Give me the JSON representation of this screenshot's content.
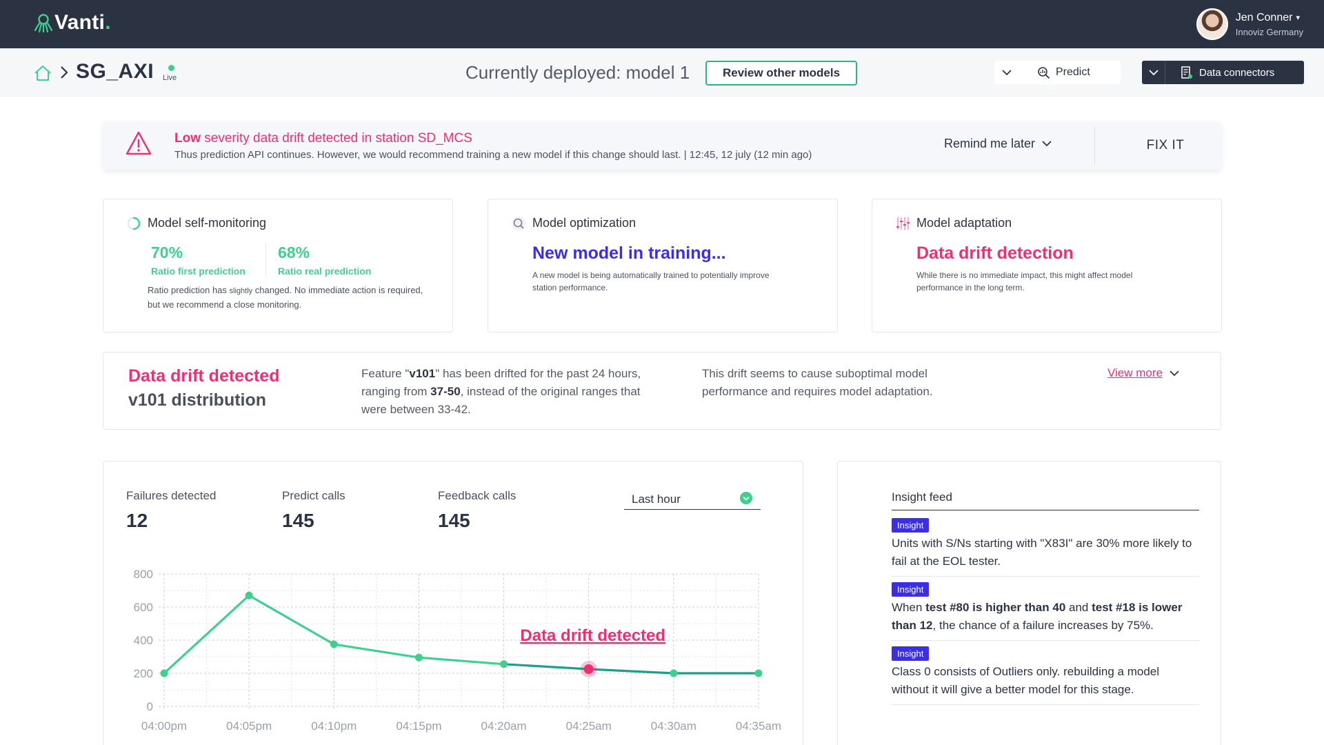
{
  "header": {
    "logo_text": "Vanti",
    "logo_dot": ".",
    "user_name": "Jen Conner",
    "user_org": "Innoviz Germany"
  },
  "subbar": {
    "station": "SG_AXI",
    "live": "Live",
    "deployed": "Currently deployed: model 1",
    "review_btn": "Review other models",
    "predict": "Predict",
    "data_connectors": "Data connectors"
  },
  "alert": {
    "severity": "Low",
    "title_rest": " severity data drift detected in station SD_MCS",
    "subtitle": "Thus prediction API continues. However, we would recommend training a new model if this change should last. | 12:45, 12 july (12 min ago)",
    "remind": "Remind me later",
    "fix": "FIX IT"
  },
  "cards": {
    "monitoring": {
      "title": "Model self-monitoring",
      "m1_value": "70%",
      "m1_label": "Ratio first prediction",
      "m2_value": "68%",
      "m2_label": "Ratio real prediction",
      "desc_a": "Ratio prediction has ",
      "desc_small": "slightly",
      "desc_b": " changed. No immediate action is required, but we recommend a close monitoring."
    },
    "optimization": {
      "title": "Model optimization",
      "headline": "New model in training...",
      "desc": "A new model is being automatically trained to potentially improve station performance."
    },
    "adaptation": {
      "title": "Model adaptation",
      "headline": "Data drift detection",
      "desc": "While there is no immediate impact, this might affect model performance in the long term."
    }
  },
  "drift": {
    "title": "Data drift detected",
    "subtitle": "v101 distribution",
    "t1_a": "Feature \"",
    "t1_feature": "v101",
    "t1_b": "\" has been drifted for the past 24 hours, ranging from ",
    "t1_range": "37-50",
    "t1_c": ", instead of the original ranges that were between 33-42.",
    "t2": "This drift seems to cause suboptimal model performance and requires model adaptation.",
    "view_more": "View more"
  },
  "kpis": {
    "failures_label": "Failures detected",
    "failures_value": "12",
    "predict_label": "Predict calls",
    "predict_value": "145",
    "feedback_label": "Feedback calls",
    "feedback_value": "145",
    "range": "Last hour"
  },
  "chart_data": {
    "type": "line",
    "x": [
      "04:00pm",
      "04:05pm",
      "04:10pm",
      "04:15pm",
      "04:20am",
      "04:25am",
      "04:30am",
      "04:35am"
    ],
    "series": [
      {
        "values": [
          200,
          670,
          375,
          295,
          255,
          225,
          200,
          200
        ]
      }
    ],
    "yticks": [
      0,
      200,
      400,
      600,
      800
    ],
    "ylim": [
      0,
      800
    ],
    "annotation": {
      "text": "Data drift detected",
      "x": "04:25am",
      "y": 225
    },
    "colors": {
      "line": "#3fd08f",
      "line_after": "#1b9e8c",
      "annotation": "#ee2f74",
      "grid": "#c9ccd3",
      "axis_text": "#9aa0ab"
    },
    "grid": true
  },
  "insights": {
    "title": "Insight feed",
    "badge": "Insight",
    "i1": "Units with S/Ns starting with \"X83I\" are 30% more likely to fail at the EOL tester.",
    "i2_a": "When ",
    "i2_b1": "test #80 is higher than 40",
    "i2_c": " and ",
    "i2_b2": "test #18 is lower than 12",
    "i2_d": ", the chance of a failure increases by 75%.",
    "i3": "Class 0 consists of Outliers only. rebuilding a model without it will give a better model for this stage."
  },
  "colors": {
    "accent_green": "#3fd08f",
    "accent_pink": "#ee2f74",
    "accent_purple": "#3b2ee8",
    "navy": "#2b3343"
  }
}
